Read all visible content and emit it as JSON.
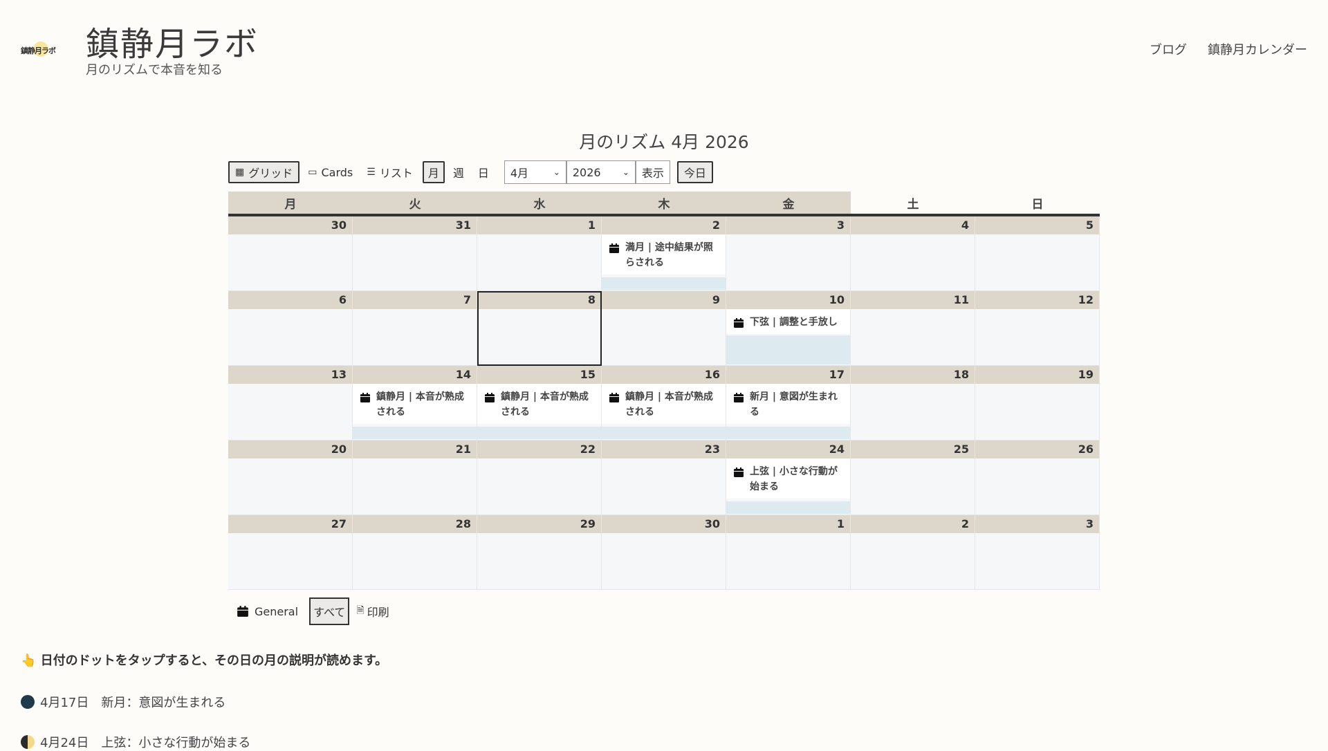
{
  "site": {
    "logo_text": "鎮静月ラボ",
    "title": "鎮静月ラボ",
    "tagline": "月のリズムで本音を知る",
    "nav": [
      "ブログ",
      "鎮静月カレンダー"
    ]
  },
  "calendar": {
    "title": "月のリズム 4月 2026",
    "toolbar": {
      "grid": "グリッド",
      "cards": "Cards",
      "list": "リスト",
      "month": "月",
      "week": "週",
      "day": "日",
      "month_select": "4月",
      "year_select": "2026",
      "show": "表示",
      "today": "今日"
    },
    "weekdays": [
      "月",
      "火",
      "水",
      "木",
      "金",
      "土",
      "日"
    ],
    "weeks": [
      [
        "30",
        "31",
        "1",
        "2",
        "3",
        "4",
        "5"
      ],
      [
        "6",
        "7",
        "8",
        "9",
        "10",
        "11",
        "12"
      ],
      [
        "13",
        "14",
        "15",
        "16",
        "17",
        "18",
        "19"
      ],
      [
        "20",
        "21",
        "22",
        "23",
        "24",
        "25",
        "26"
      ],
      [
        "27",
        "28",
        "29",
        "30",
        "1",
        "2",
        "3"
      ]
    ],
    "events": {
      "full_moon": "満月 | 途中結果が照らされる",
      "last_quarter": "下弦 | 調整と手放し",
      "calm_14": "鎮静月 | 本音が熟成される",
      "calm_15": "鎮静月 | 本音が熟成される",
      "calm_16": "鎮静月 | 本音が熟成される",
      "new_moon": "新月 | 意図が生まれる",
      "first_quarter": "上弦 | 小さな行動が始まる"
    },
    "legend": {
      "general": "General",
      "all": "すべて",
      "print": "印刷"
    }
  },
  "notes": {
    "hint": "👆 日付のドットをタップすると、その日の月の説明が読めます。",
    "items": [
      {
        "text": "4月17日　新月：意図が生まれる"
      },
      {
        "text": "4月24日　上弦：小さな行動が始まる"
      }
    ]
  },
  "colors": {
    "header_bg": "#ddd6ca",
    "cell_bg": "#f6f7f8",
    "event_bar": "#ddebf1",
    "new_moon": "#1f3a4a",
    "moon_yellow": "#f3d98a"
  },
  "icons": [
    "calendar-icon",
    "grid-icon",
    "cards-icon",
    "list-icon",
    "print-icon",
    "chevron-down-icon"
  ]
}
